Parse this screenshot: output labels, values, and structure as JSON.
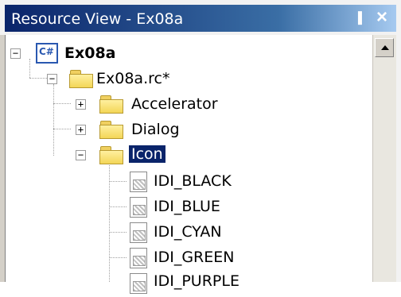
{
  "panel": {
    "title": "Resource View - Ex08a",
    "pin_glyph": "▐",
    "close_glyph": "×"
  },
  "tree": {
    "project": {
      "label": "Ex08a",
      "expander": "−",
      "icon": "project-icon",
      "icon_text": "C#"
    },
    "rc_file": {
      "label": "Ex08a.rc*",
      "expander": "−",
      "icon": "folder-icon"
    },
    "folders": [
      {
        "label": "Accelerator",
        "expander": "+",
        "icon": "folder-icon"
      },
      {
        "label": "Dialog",
        "expander": "+",
        "icon": "folder-icon"
      },
      {
        "label": "Icon",
        "expander": "−",
        "icon": "folder-icon",
        "selected": true
      }
    ],
    "icon_items": [
      {
        "label": "IDI_BLACK",
        "icon": "icon-resource-icon"
      },
      {
        "label": "IDI_BLUE",
        "icon": "icon-resource-icon"
      },
      {
        "label": "IDI_CYAN",
        "icon": "icon-resource-icon"
      },
      {
        "label": "IDI_GREEN",
        "icon": "icon-resource-icon"
      },
      {
        "label": "IDI_PURPLE",
        "icon": "icon-resource-icon"
      }
    ]
  },
  "colors": {
    "title_start": "#0a246a",
    "title_end": "#a6caf0",
    "selection": "#0a246a",
    "folder": "#f3d657"
  }
}
